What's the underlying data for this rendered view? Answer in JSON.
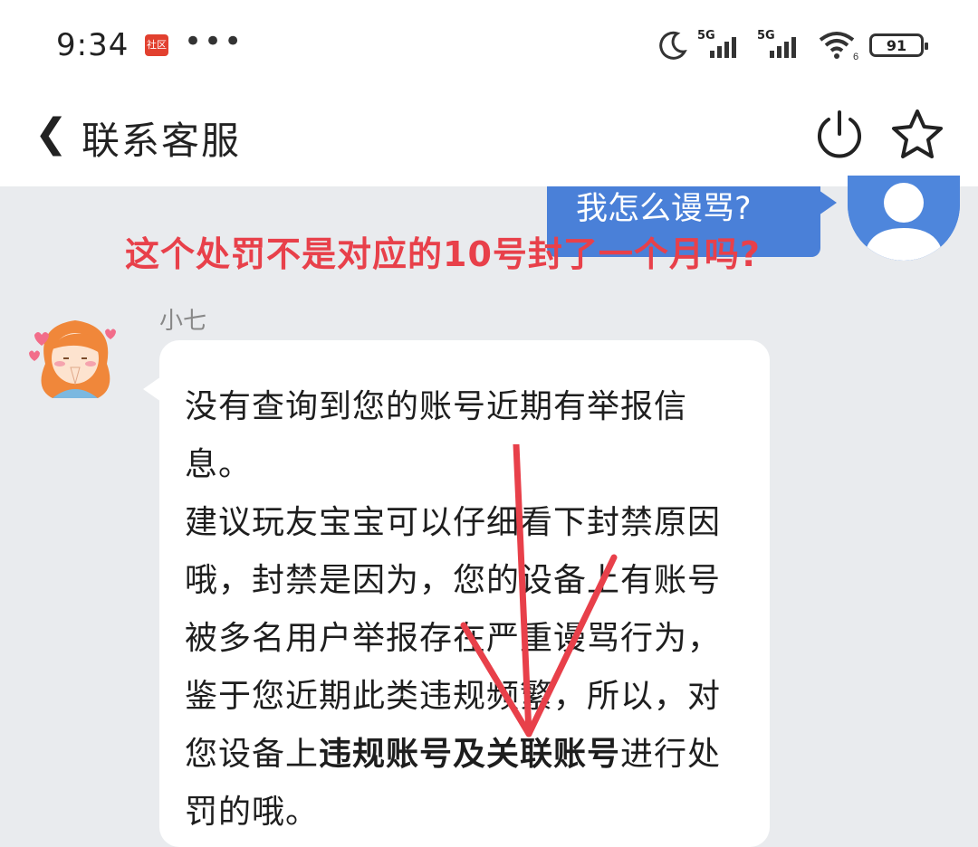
{
  "status_bar": {
    "time": "9:34",
    "app_badge": "社区",
    "more": "•••",
    "network1": "5G",
    "network2": "5G",
    "wifi_level": "6",
    "battery": "91"
  },
  "header": {
    "back": "❮",
    "title": "联系客服"
  },
  "chat": {
    "user_message": "我怎么谩骂?",
    "agent_name": "小七",
    "agent_message_part1": "没有查询到您的账号近期有举报信息。",
    "agent_message_part2": "建议玩友宝宝可以仔细看下封禁原因哦，封禁是因为，您的设备上有账号被多名用户举报存在严重谩骂行为，鉴于您近期此类违规频繁，所以，对您设备上",
    "agent_message_bold1": "违规账号",
    "agent_message_newline": "",
    "agent_message_bold2": "及关联账号",
    "agent_message_part3": "进行处罚的哦。"
  },
  "annotation": {
    "text": "这个处罚不是对应的10号封了一个月吗?"
  },
  "colors": {
    "user_bubble": "#4a80d8",
    "annotation": "#e8404a",
    "background": "#e9ebee"
  }
}
